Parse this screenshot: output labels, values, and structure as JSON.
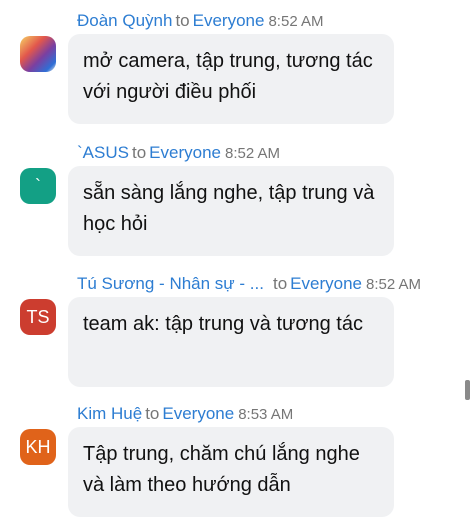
{
  "chat": {
    "messages": [
      {
        "sender": "Đoàn Quỳnh",
        "to_word": "to",
        "recipient": "Everyone",
        "time": "8:52 AM",
        "avatar": {
          "type": "photo",
          "initials": "",
          "color": "#7b3fa0"
        },
        "text": "mở camera, tập trung, tương tác với người điều phối"
      },
      {
        "sender": "`ASUS",
        "to_word": "to",
        "recipient": "Everyone",
        "time": "8:52 AM",
        "avatar": {
          "type": "initials",
          "initials": "`",
          "color": "#13a085"
        },
        "text": "sẵn sàng lắng nghe, tập trung và học hỏi"
      },
      {
        "sender": "Tú Sương - Nhân sự - ...",
        "to_word": "to",
        "recipient": "Everyone",
        "time": "8:52 AM",
        "avatar": {
          "type": "initials",
          "initials": "TS",
          "color": "#cc3d2f"
        },
        "text": "team ak: tập trung và tương tác"
      },
      {
        "sender": "Kim Huệ",
        "to_word": "to",
        "recipient": "Everyone",
        "time": "8:53 AM",
        "avatar": {
          "type": "initials",
          "initials": "KH",
          "color": "#e0631a"
        },
        "text": "Tập trung, chăm chú lắng nghe và làm theo hướng dẫn"
      }
    ]
  }
}
